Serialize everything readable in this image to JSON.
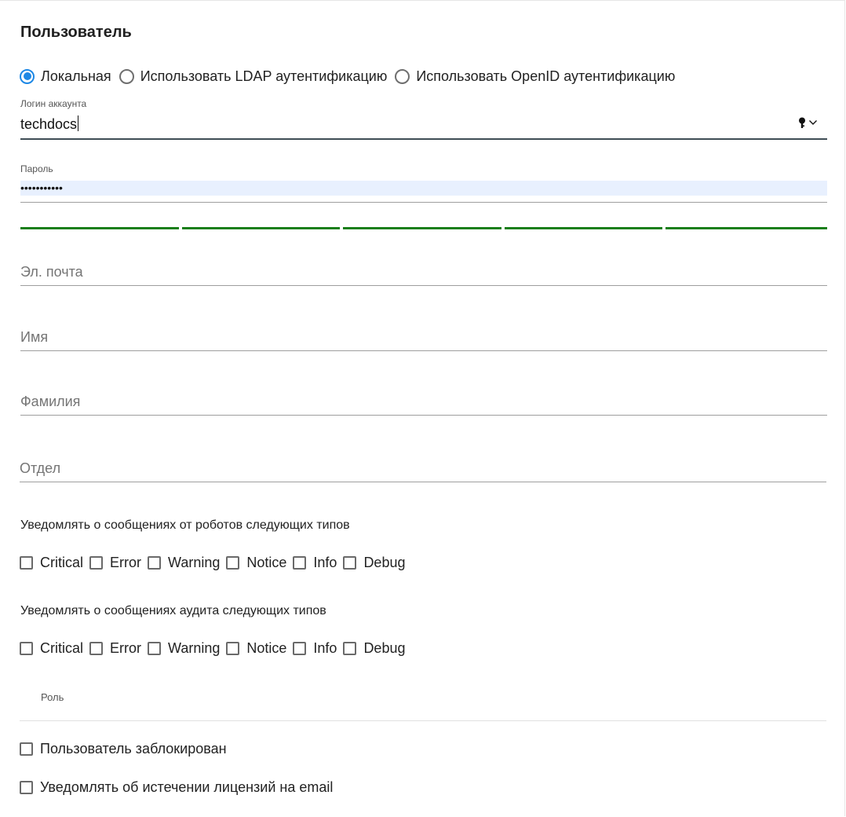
{
  "dialog": {
    "title": "Пользователь"
  },
  "auth": {
    "options": [
      {
        "label": "Локальная",
        "checked": true
      },
      {
        "label": "Использовать LDAP аутентификацию",
        "checked": false
      },
      {
        "label": "Использовать OpenID аутентификацию",
        "checked": false
      }
    ]
  },
  "login": {
    "label": "Логин аккаунта",
    "value": "techdocs"
  },
  "password": {
    "label": "Пароль",
    "value": "•••••••••••",
    "strength_segments_filled": 5,
    "strength_segments_total": 5,
    "strength_color": "#1b7f1b"
  },
  "email": {
    "placeholder": "Эл. почта"
  },
  "first_name": {
    "placeholder": "Имя"
  },
  "last_name": {
    "placeholder": "Фамилия"
  },
  "department": {
    "placeholder": "Отдел"
  },
  "robot_notifications": {
    "title": "Уведомлять о сообщениях от роботов следующих типов",
    "types": [
      "Critical",
      "Error",
      "Warning",
      "Notice",
      "Info",
      "Debug"
    ]
  },
  "audit_notifications": {
    "title": "Уведомлять о сообщениях аудита следующих типов",
    "types": [
      "Critical",
      "Error",
      "Warning",
      "Notice",
      "Info",
      "Debug"
    ]
  },
  "role": {
    "label": "Роль"
  },
  "blocked": {
    "label": "Пользователь заблокирован",
    "checked": false
  },
  "license_email": {
    "label": "Уведомлять об истечении лицензий на email",
    "checked": false
  },
  "colors": {
    "accent": "#1e88e5",
    "strength": "#1b7f1b",
    "autofill_bg": "#e8f0fe"
  },
  "icons": {
    "password_manager": "key-icon",
    "dropdown": "chevron-down-icon"
  }
}
